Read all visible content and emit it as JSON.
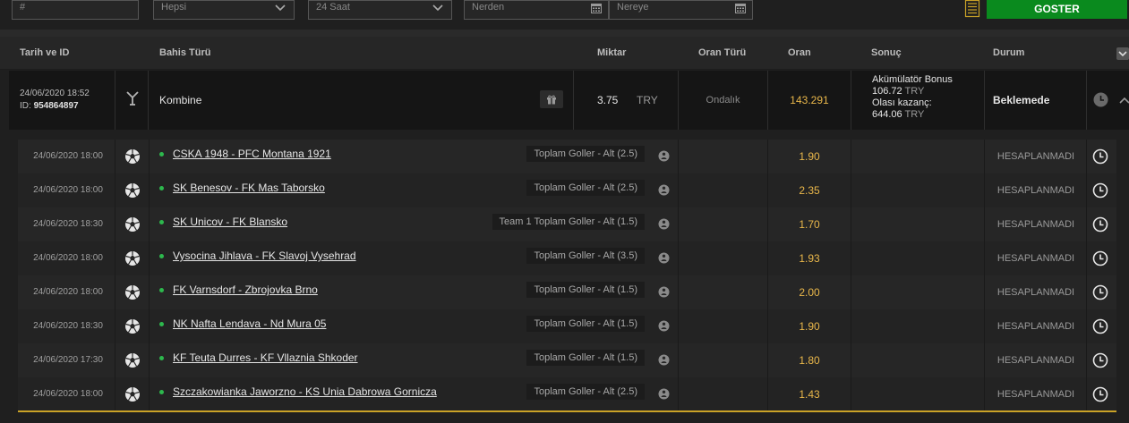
{
  "filters": {
    "id_placeholder": "#",
    "type_value": "Hepsi",
    "period_value": "24 Saat",
    "from_placeholder": "Nerden",
    "to_placeholder": "Nereye",
    "submit_label": "GOSTER",
    "list_icon": "list-document-icon"
  },
  "header": {
    "date_id": "Tarih ve ID",
    "bet_type": "Bahis Türü",
    "amount": "Miktar",
    "odds_type": "Oran Türü",
    "odds": "Oran",
    "result": "Sonuç",
    "status": "Durum"
  },
  "bet": {
    "date": "24/06/2020 18:52",
    "id_label": "ID:",
    "id_value": "954864897",
    "type": "Kombine",
    "amount": "3.75",
    "currency": "TRY",
    "odds_type": "Ondalık",
    "odds": "143.291",
    "bonus_label": "Akümülatör Bonus",
    "bonus_value": "106.72",
    "bonus_currency": "TRY",
    "potential_label": "Olası kazanç:",
    "potential_value": "644.06",
    "potential_currency": "TRY",
    "status": "Beklemede"
  },
  "legs": [
    {
      "date": "24/06/2020 18:00",
      "match": "CSKA 1948 - PFC Montana 1921",
      "market": "Toplam Goller - Alt (2.5)",
      "odds": "1.90",
      "status": "HESAPLANMADI"
    },
    {
      "date": "24/06/2020 18:00",
      "match": "SK Benesov - FK Mas Taborsko",
      "market": "Toplam Goller - Alt (2.5)",
      "odds": "2.35",
      "status": "HESAPLANMADI"
    },
    {
      "date": "24/06/2020 18:30",
      "match": "SK Unicov - FK Blansko",
      "market": "Team 1 Toplam Goller - Alt (1.5)",
      "odds": "1.70",
      "status": "HESAPLANMADI"
    },
    {
      "date": "24/06/2020 18:00",
      "match": "Vysocina Jihlava - FK Slavoj Vysehrad",
      "market": "Toplam Goller - Alt (3.5)",
      "odds": "1.93",
      "status": "HESAPLANMADI"
    },
    {
      "date": "24/06/2020 18:00",
      "match": "FK Varnsdorf - Zbrojovka Brno",
      "market": "Toplam Goller - Alt (1.5)",
      "odds": "2.00",
      "status": "HESAPLANMADI"
    },
    {
      "date": "24/06/2020 18:30",
      "match": "NK Nafta Lendava - Nd Mura 05",
      "market": "Toplam Goller - Alt (1.5)",
      "odds": "1.90",
      "status": "HESAPLANMADI"
    },
    {
      "date": "24/06/2020 17:30",
      "match": "KF Teuta Durres - KF Vllaznia Shkoder",
      "market": "Toplam Goller - Alt (1.5)",
      "odds": "1.80",
      "status": "HESAPLANMADI"
    },
    {
      "date": "24/06/2020 18:00",
      "match": "Szczakowianka Jaworzno - KS Unia Dabrowa Gornicza",
      "market": "Toplam Goller - Alt (2.5)",
      "odds": "1.43",
      "status": "HESAPLANMADI"
    }
  ],
  "colors": {
    "accent_green": "#0a8a1e",
    "odds_gold": "#e8b64a",
    "live_dot": "#2db84d"
  }
}
